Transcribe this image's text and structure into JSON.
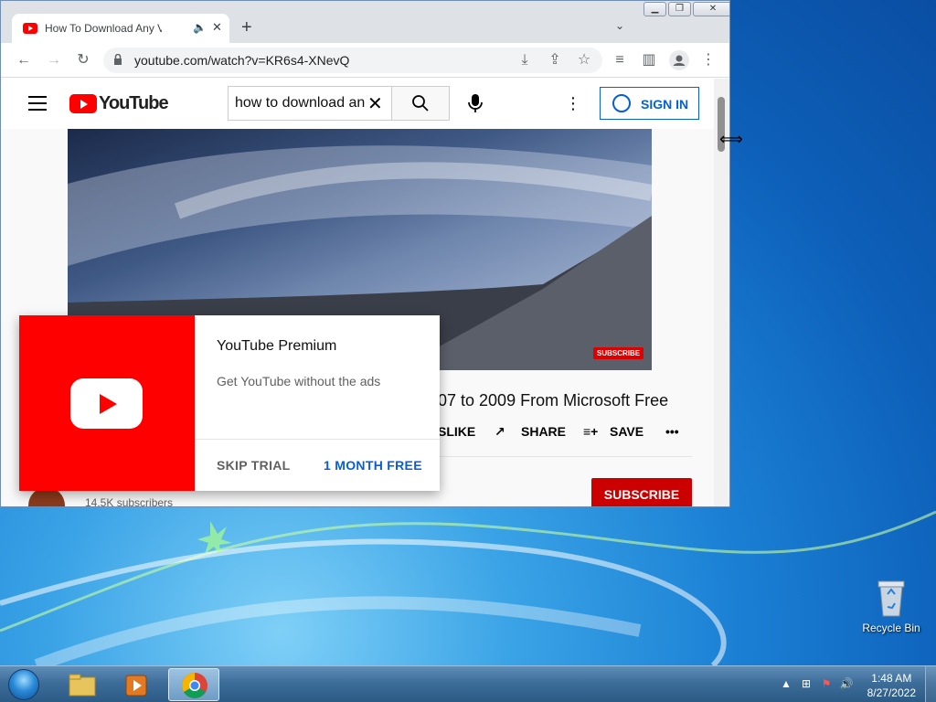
{
  "desktop": {
    "recycle_bin_label": "Recycle Bin"
  },
  "taskbar": {
    "clock_time": "1:48 AM",
    "clock_date": "8/27/2022",
    "apps": [
      "windows-explorer",
      "windows-media-player",
      "google-chrome"
    ]
  },
  "browser": {
    "tab_title": "How To Download Any Versi",
    "url": "youtube.com/watch?v=KR6s4-XNevQ"
  },
  "youtube": {
    "logo_text": "YouTube",
    "search_query": "how to download an",
    "sign_in": "SIGN IN",
    "video_title": "07 to 2009 From Microsoft Free",
    "video_watermark": "SUBSCRIBE",
    "actions": {
      "dislike": "SLIKE",
      "share": "SHARE",
      "save": "SAVE"
    },
    "subscribe": "SUBSCRIBE",
    "subscribers": "14.5K subscribers"
  },
  "promo": {
    "title": "YouTube Premium",
    "description": "Get YouTube without the ads",
    "skip": "SKIP TRIAL",
    "cta": "1 MONTH FREE"
  },
  "colors": {
    "youtube_red": "#ff0000",
    "link_blue": "#065fd4",
    "subscribe_red": "#cc0000"
  }
}
